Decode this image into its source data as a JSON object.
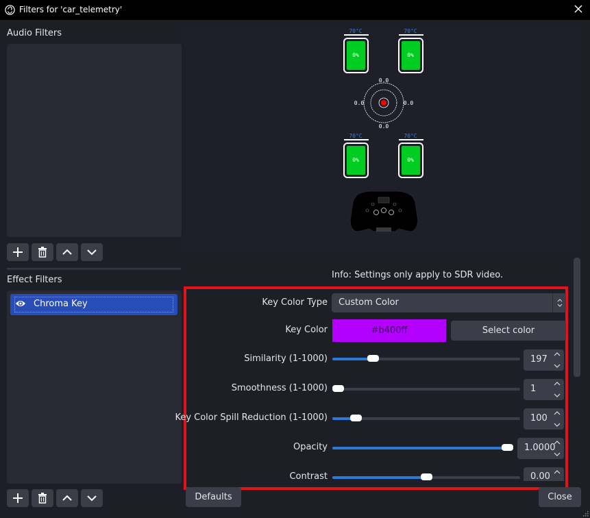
{
  "window": {
    "title": "Filters for 'car_telemetry'",
    "icon": "obs-logo-icon",
    "close_icon": "close-icon"
  },
  "audio_filters": {
    "label": "Audio Filters",
    "items": [],
    "buttons": [
      "add-icon",
      "trash-icon",
      "chevron-up-icon",
      "chevron-down-icon"
    ]
  },
  "effect_filters": {
    "label": "Effect Filters",
    "items": [
      {
        "label": "Chroma Key",
        "visible": true,
        "selected": true,
        "icon": "eye-icon"
      }
    ],
    "buttons": [
      "add-icon",
      "trash-icon",
      "chevron-up-icon",
      "chevron-down-icon"
    ]
  },
  "preview": {
    "tires": [
      {
        "temp": "70°C",
        "wear": "0%"
      },
      {
        "temp": "70°C",
        "wear": "0%"
      },
      {
        "temp": "70°C",
        "wear": "0%"
      },
      {
        "temp": "70°C",
        "wear": "0%"
      }
    ],
    "gforce": {
      "top": "0.0",
      "bottom": "0.0",
      "left": "0.0",
      "right": "0.0"
    },
    "colors": {
      "tire_fill": "#00cc22",
      "temp_text": "#3a7bd5",
      "gforce_dot": "#ff0000"
    }
  },
  "settings": {
    "info": "Info: Settings only apply to SDR video.",
    "key_color_type": {
      "label": "Key Color Type",
      "value": "Custom Color"
    },
    "key_color": {
      "label": "Key Color",
      "value": "#b400ff",
      "button": "Select color"
    },
    "similarity": {
      "label": "Similarity (1-1000)",
      "value": "197",
      "fraction": 0.197
    },
    "smoothness": {
      "label": "Smoothness (1-1000)",
      "value": "1",
      "fraction": 0.0
    },
    "spill": {
      "label": "Key Color Spill Reduction (1-1000)",
      "value": "100",
      "fraction": 0.1
    },
    "opacity": {
      "label": "Opacity",
      "value": "1.0000",
      "fraction": 1.0
    },
    "contrast": {
      "label": "Contrast",
      "value": "0.00",
      "fraction": 0.5
    }
  },
  "footer": {
    "defaults": "Defaults",
    "close": "Close"
  },
  "colors": {
    "accent": "#2d7ad6",
    "selection": "#284cb8",
    "highlight_box": "#e2131c"
  }
}
